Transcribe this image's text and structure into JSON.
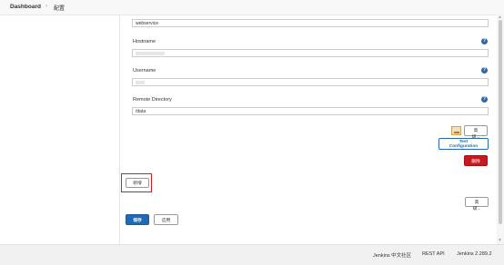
{
  "breadcrumb": {
    "home": "Dashboard",
    "separator": "›",
    "current": "配置"
  },
  "form": {
    "name_value": "webservice",
    "hostname": {
      "label": "Hostname"
    },
    "username": {
      "label": "Username"
    },
    "remote_directory": {
      "label": "Remote Directory",
      "value": "/data"
    },
    "help_glyph": "?"
  },
  "buttons": {
    "advanced_server": "高级...",
    "test_configuration": "Test Configuration",
    "delete": "删除",
    "add": "新增",
    "advanced_bottom": "高级...",
    "save": "保存",
    "apply": "应用"
  },
  "footer": {
    "community": "Jenkins 中文社区",
    "rest_api": "REST API",
    "version": "Jenkins 2.289.2"
  },
  "colors": {
    "primary": "#2169b5",
    "danger": "#c9181e",
    "highlight": "#e0191c"
  }
}
